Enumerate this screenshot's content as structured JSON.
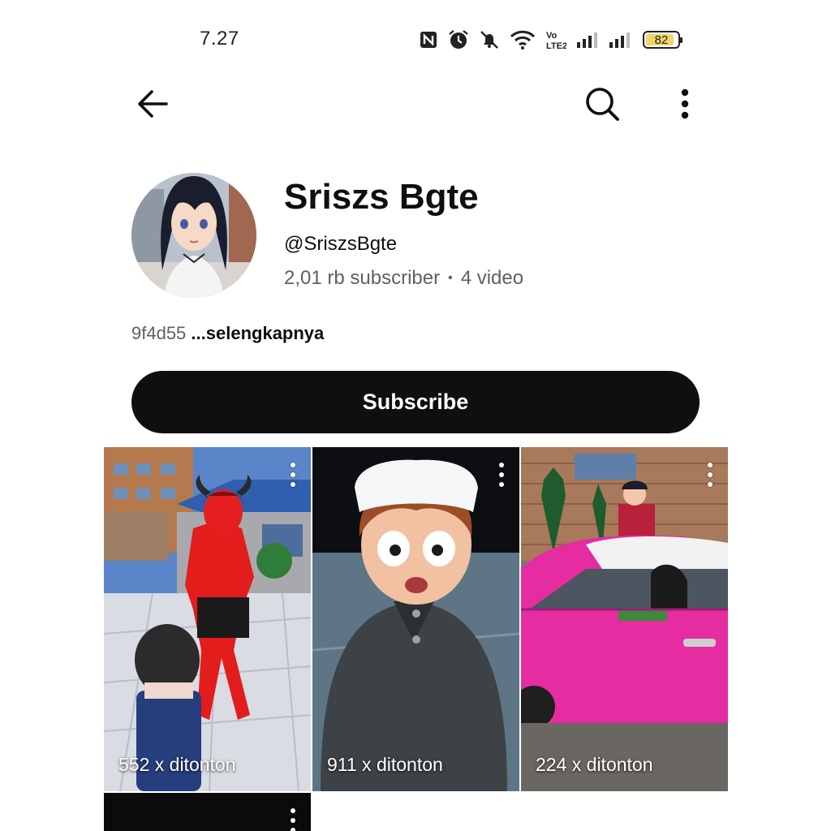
{
  "status_bar": {
    "time": "7.27",
    "battery_percent": "82",
    "icons": [
      "nfc-icon",
      "alarm-icon",
      "mute-icon",
      "wifi-icon",
      "volte-icon",
      "signal-icon",
      "signal-icon-2",
      "battery-icon"
    ]
  },
  "app_bar": {
    "icons": [
      "back-arrow-icon",
      "search-icon",
      "more-vert-icon"
    ]
  },
  "channel": {
    "name": "Sriszs Bgte",
    "handle": "@SriszsBgte",
    "subscribers": "2,01 rb subscriber",
    "separator": "•",
    "videos": "4 video",
    "description": "9f4d55",
    "more_label": "...selengkapnya"
  },
  "subscribe_label": "Subscribe",
  "shorts": [
    {
      "views": "552 x ditonton"
    },
    {
      "views": "911 x ditonton"
    },
    {
      "views": "224 x ditonton"
    },
    {
      "views": ""
    }
  ],
  "colors": {
    "button_bg": "#0f0f0f",
    "secondary_text": "#606060",
    "battery_fill": "#f3d46a"
  }
}
